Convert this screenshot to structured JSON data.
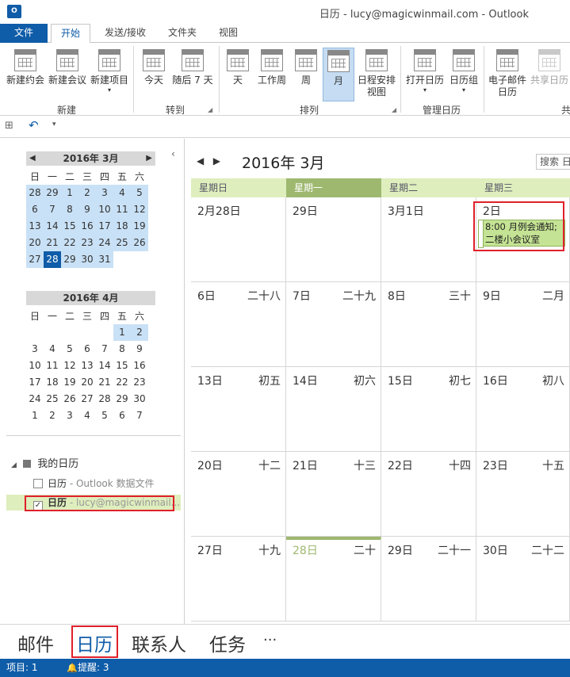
{
  "window": {
    "title": "日历 - lucy@magicwinmail.com - Outlook",
    "app_icon": "O"
  },
  "tabs": [
    "文件",
    "开始",
    "发送/接收",
    "文件夹",
    "视图"
  ],
  "ribbon": {
    "buttons": [
      "新建约会",
      "新建会议",
      "新建项目",
      "今天",
      "随后 7 天",
      "天",
      "工作周",
      "周",
      "月",
      "日程安排",
      "视图",
      "打开日历",
      "日历组",
      "电子邮件",
      "日历",
      "共享日历"
    ],
    "groups": [
      "新建",
      "转到",
      "排列",
      "管理日历",
      "共享"
    ]
  },
  "mini_march": {
    "header": "2016年 3月",
    "dow": [
      "日",
      "一",
      "二",
      "三",
      "四",
      "五",
      "六"
    ],
    "days": [
      "28",
      "29",
      "1",
      "2",
      "3",
      "4",
      "5",
      "6",
      "7",
      "8",
      "9",
      "10",
      "11",
      "12",
      "13",
      "14",
      "15",
      "16",
      "17",
      "18",
      "19",
      "20",
      "21",
      "22",
      "23",
      "24",
      "25",
      "26",
      "27",
      "28",
      "29",
      "30",
      "31"
    ]
  },
  "mini_april": {
    "header": "2016年 4月",
    "days": [
      "1",
      "2",
      "3",
      "4",
      "5",
      "6",
      "7",
      "8",
      "9",
      "10",
      "11",
      "12",
      "13",
      "14",
      "15",
      "16",
      "17",
      "18",
      "19",
      "20",
      "21",
      "22",
      "23",
      "24",
      "25",
      "26",
      "27",
      "28",
      "29",
      "30",
      "1",
      "2",
      "3",
      "4",
      "5",
      "6",
      "7"
    ]
  },
  "folders": {
    "group": "我的日历",
    "item1_name": "日历",
    "item1_sub": " - Outlook 数据文件",
    "item2_name": "日历",
    "item2_sub": " - lucy@magicwinmail..."
  },
  "calendar": {
    "title": "2016年 3月",
    "search_placeholder": "搜索 日",
    "dow": [
      "星期日",
      "星期一",
      "星期二",
      "星期三"
    ],
    "rows": [
      [
        [
          "2月28日",
          ""
        ],
        [
          "29日",
          ""
        ],
        [
          "3月1日",
          ""
        ],
        [
          "2日",
          ""
        ]
      ],
      [
        [
          "6日",
          "二十八"
        ],
        [
          "7日",
          "二十九"
        ],
        [
          "8日",
          "三十"
        ],
        [
          "9日",
          "二月"
        ]
      ],
      [
        [
          "13日",
          "初五"
        ],
        [
          "14日",
          "初六"
        ],
        [
          "15日",
          "初七"
        ],
        [
          "16日",
          "初八"
        ]
      ],
      [
        [
          "20日",
          "十二"
        ],
        [
          "21日",
          "十三"
        ],
        [
          "22日",
          "十四"
        ],
        [
          "23日",
          "十五"
        ]
      ],
      [
        [
          "27日",
          "十九"
        ],
        [
          "28日",
          "二十"
        ],
        [
          "29日",
          "二十一"
        ],
        [
          "30日",
          "二十二"
        ]
      ]
    ],
    "event_line1": "8:00 月例会通知;",
    "event_line2": "二楼小会议室"
  },
  "bottom_nav": [
    "邮件",
    "日历",
    "联系人",
    "任务",
    "···"
  ],
  "status": {
    "items": "项目: 1",
    "reminders": "提醒: 3"
  }
}
